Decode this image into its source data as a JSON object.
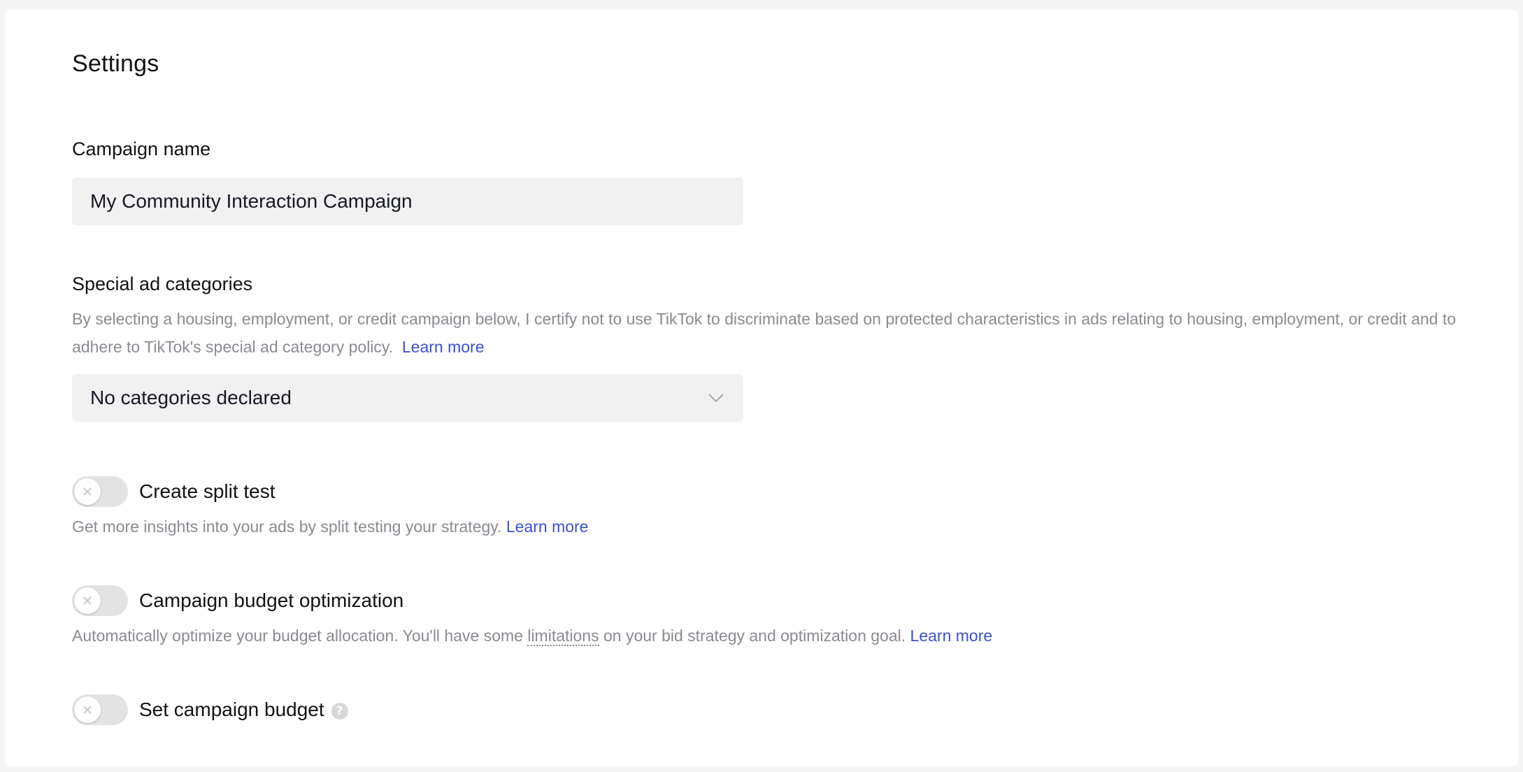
{
  "page": {
    "title": "Settings"
  },
  "campaign_name": {
    "label": "Campaign name",
    "value": "My Community Interaction Campaign"
  },
  "special_ad": {
    "label": "Special ad categories",
    "description": "By selecting a housing, employment, or credit campaign below, I certify not to use TikTok to discriminate based on protected characteristics in ads relating to housing, employment, or credit and to adhere to TikTok's special ad category policy.",
    "learn_more": "Learn more",
    "selected": "No categories declared"
  },
  "split_test": {
    "label": "Create split test",
    "enabled": false,
    "description": "Get more insights into your ads by split testing your strategy.",
    "learn_more": "Learn more"
  },
  "budget_optimization": {
    "label": "Campaign budget optimization",
    "enabled": false,
    "description_before": "Automatically optimize your budget allocation. You'll have some",
    "description_term": "limitations",
    "description_after": "on your bid strategy and optimization goal.",
    "learn_more": "Learn more"
  },
  "campaign_budget": {
    "label": "Set campaign budget",
    "enabled": false,
    "help_glyph": "?"
  },
  "colors": {
    "link": "#3a50d6",
    "muted_text": "#8a8b91",
    "field_bg": "#f1f1f2",
    "toggle_off": "#e3e3e4"
  }
}
